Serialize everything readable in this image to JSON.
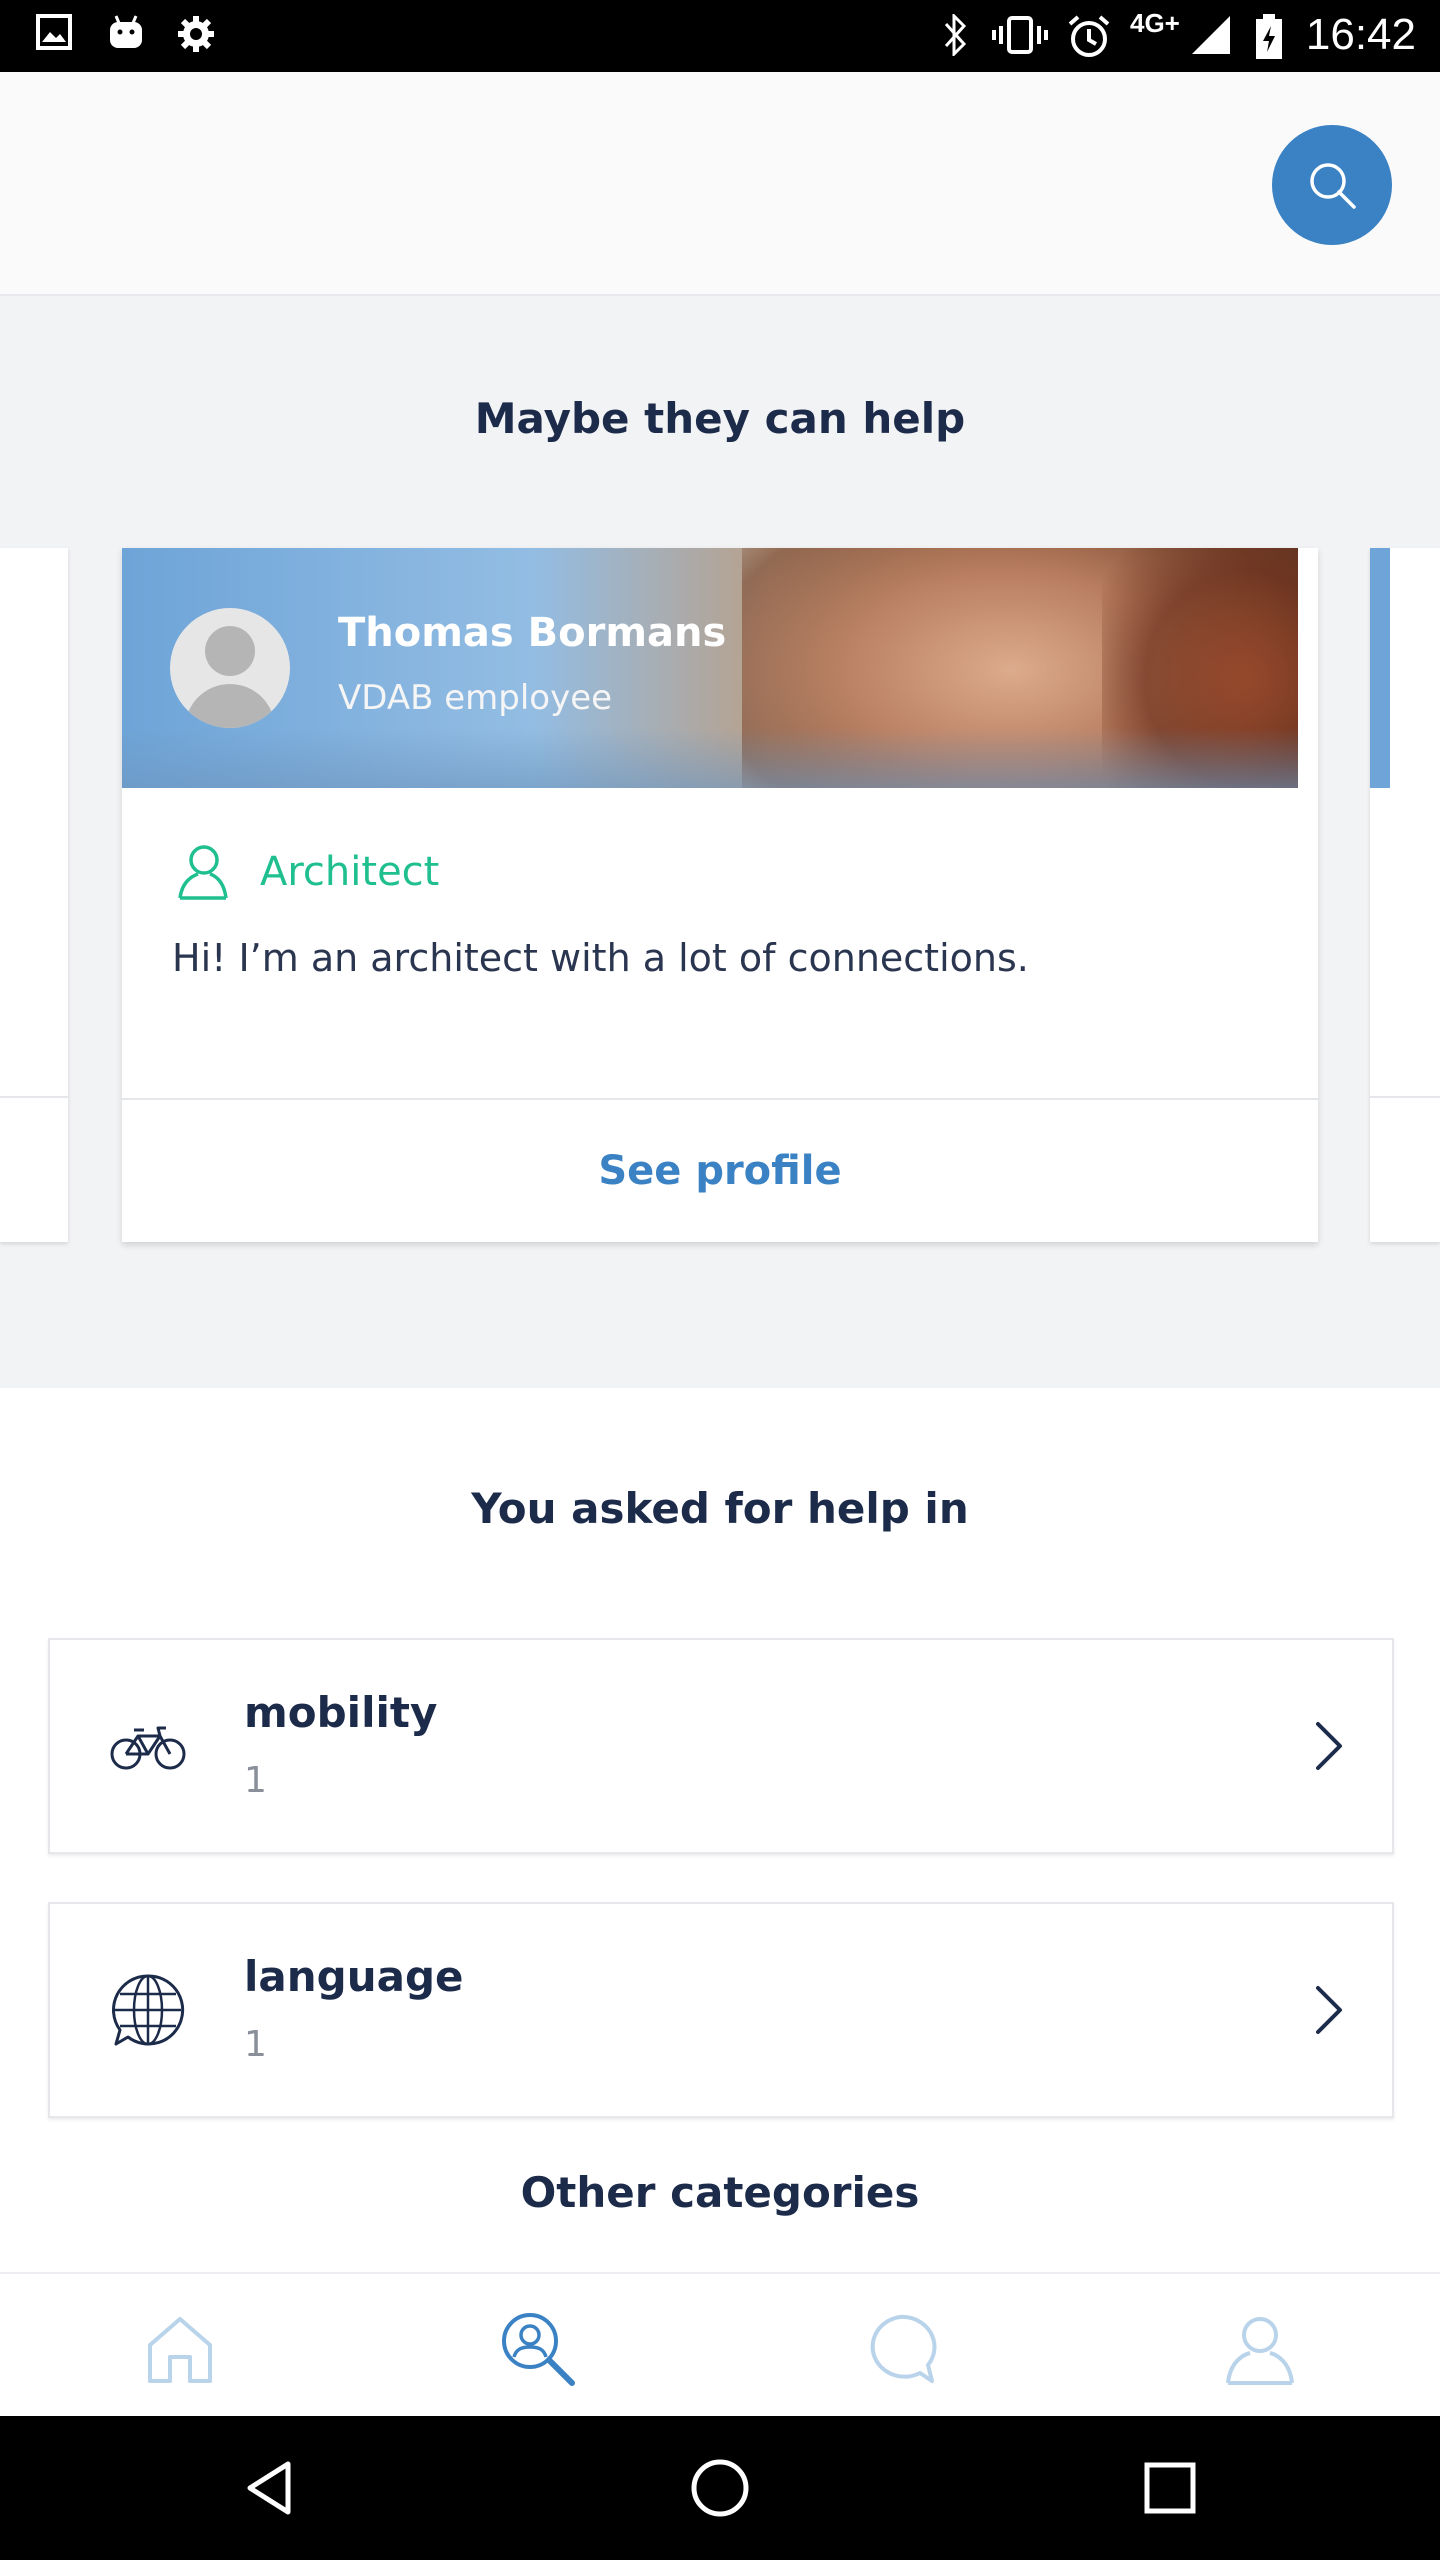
{
  "status_bar": {
    "time": "16:42",
    "network": "4G+",
    "icons": [
      "image-icon",
      "android-icon",
      "settings-icon",
      "bluetooth-icon",
      "vibrate-icon",
      "alarm-icon",
      "signal-icon",
      "battery-icon"
    ]
  },
  "header": {
    "search_icon": "search-icon",
    "accent_color": "#3b82c4"
  },
  "maybe_section": {
    "title": "Maybe they can help",
    "card": {
      "name": "Thomas Bormans",
      "role": "VDAB employee",
      "job_icon": "person-outline-icon",
      "job": "Architect",
      "bio": "Hi! I’m an architect with a lot of connections.",
      "action": "See profile"
    }
  },
  "asked_section": {
    "title": "You asked for help in",
    "items": [
      {
        "icon": "bicycle-icon",
        "name": "mobility",
        "count": "1"
      },
      {
        "icon": "globe-chat-icon",
        "name": "language",
        "count": "1"
      }
    ],
    "other_title": "Other categories"
  },
  "bottom_nav": {
    "items": [
      "home-icon",
      "search-people-icon",
      "chat-icon",
      "profile-icon"
    ],
    "active_color": "#3b82c4",
    "inactive_color": "#b9d3ea"
  },
  "system_nav": [
    "back-icon",
    "home-circle-icon",
    "recents-icon"
  ]
}
